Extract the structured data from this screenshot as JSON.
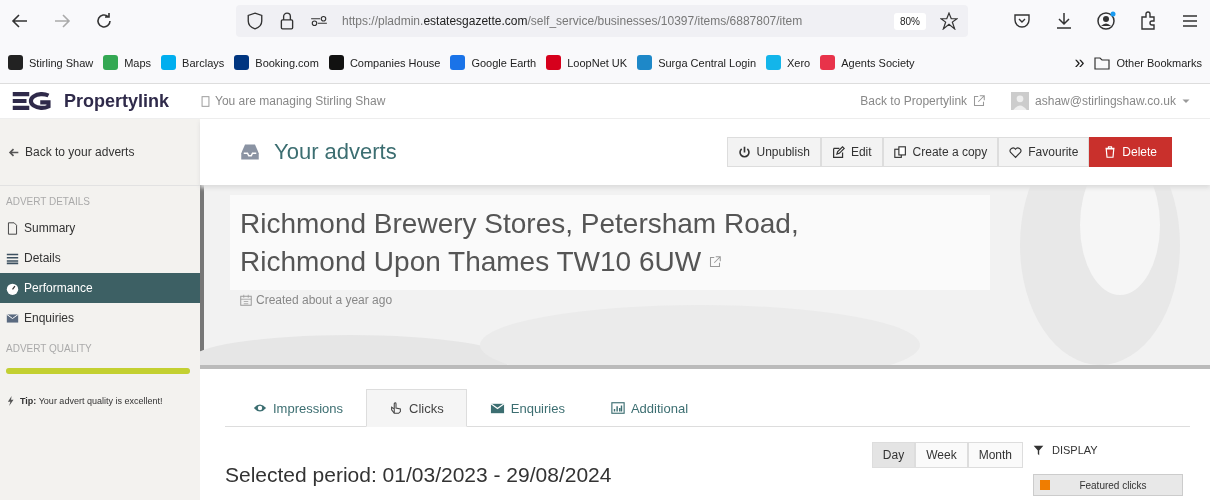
{
  "browser": {
    "url_prefix": "https://pladmin.",
    "url_domain": "estatesgazette.com",
    "url_path": "/self_service/businesses/10397/items/6887807/item",
    "zoom": "80%"
  },
  "bookmarks": [
    {
      "label": "Stirling Shaw",
      "color": "#222222"
    },
    {
      "label": "Maps",
      "color": "#34a853"
    },
    {
      "label": "Barclays",
      "color": "#00aeef"
    },
    {
      "label": "Booking.com",
      "color": "#003580"
    },
    {
      "label": "Companies House",
      "color": "#111111"
    },
    {
      "label": "Google Earth",
      "color": "#1a73e8"
    },
    {
      "label": "LoopNet UK",
      "color": "#d6001c"
    },
    {
      "label": "Surga Central Login",
      "color": "#1e88c8"
    },
    {
      "label": "Xero",
      "color": "#13b5ea"
    },
    {
      "label": "Agents Society",
      "color": "#e8334a"
    }
  ],
  "bookmarks_more": "»",
  "other_bookmarks": "Other Bookmarks",
  "header": {
    "brand": "Propertylink",
    "managing": "You are managing Stirling Shaw",
    "back_link": "Back to Propertylink",
    "user": "ashaw@stirlingshaw.co.uk"
  },
  "sidebar": {
    "back": "Back to your adverts",
    "section": "ADVERT DETAILS",
    "items": [
      {
        "label": "Summary",
        "selected": false
      },
      {
        "label": "Details",
        "selected": false
      },
      {
        "label": "Performance",
        "selected": true
      },
      {
        "label": "Enquiries",
        "selected": false
      }
    ],
    "quality_title": "ADVERT QUALITY",
    "quality": {
      "level": 1
    },
    "tip_label": "Tip:",
    "tip_text": "Your advert quality is excellent!"
  },
  "page_title": "Your adverts",
  "actions": [
    {
      "label": "Unpublish",
      "kind": "power"
    },
    {
      "label": "Edit",
      "kind": "edit"
    },
    {
      "label": "Create a copy",
      "kind": "copy"
    },
    {
      "label": "Favourite",
      "kind": "heart"
    },
    {
      "label": "Delete",
      "kind": "delete"
    }
  ],
  "advert": {
    "title_line1": "Richmond Brewery Stores, Petersham Road,",
    "title_line2": "Richmond Upon Thames TW10 6UW",
    "created": "Created about a year ago"
  },
  "tabs": [
    {
      "label": "Impressions",
      "kind": "eye",
      "selected": false
    },
    {
      "label": "Clicks",
      "kind": "hand",
      "selected": true
    },
    {
      "label": "Enquiries",
      "kind": "mail",
      "selected": false
    },
    {
      "label": "Additional",
      "kind": "chart",
      "selected": false
    }
  ],
  "period": "Selected period: 01/03/2023 - 29/08/2024",
  "granularity": [
    {
      "label": "Day",
      "selected": true
    },
    {
      "label": "Week",
      "selected": false
    },
    {
      "label": "Month",
      "selected": false
    }
  ],
  "display_title": "DISPLAY",
  "legend": [
    {
      "label": "Featured clicks",
      "color": "#f07d00"
    }
  ]
}
